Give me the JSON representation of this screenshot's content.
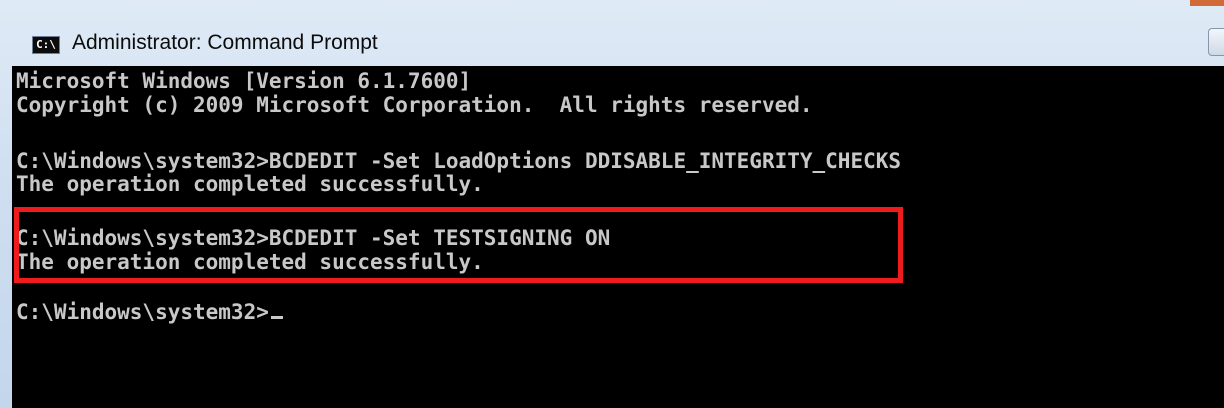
{
  "window": {
    "title": "Administrator: Command Prompt",
    "icon": "command-prompt-icon",
    "icon_text": "C:\\"
  },
  "console": {
    "lines": [
      "Microsoft Windows [Version 6.1.7600]",
      "Copyright (c) 2009 Microsoft Corporation.  All rights reserved.",
      "",
      "C:\\Windows\\system32>BCDEDIT -Set LoadOptions DDISABLE_INTEGRITY_CHECKS",
      "The operation completed successfully.",
      "",
      "C:\\Windows\\system32>BCDEDIT -Set TESTSIGNING ON",
      "The operation completed successfully.",
      "",
      "C:\\Windows\\system32>"
    ]
  },
  "colors": {
    "console_background": "#000000",
    "console_text": "#c8c8c8",
    "highlight_border": "#ee1c1c"
  }
}
